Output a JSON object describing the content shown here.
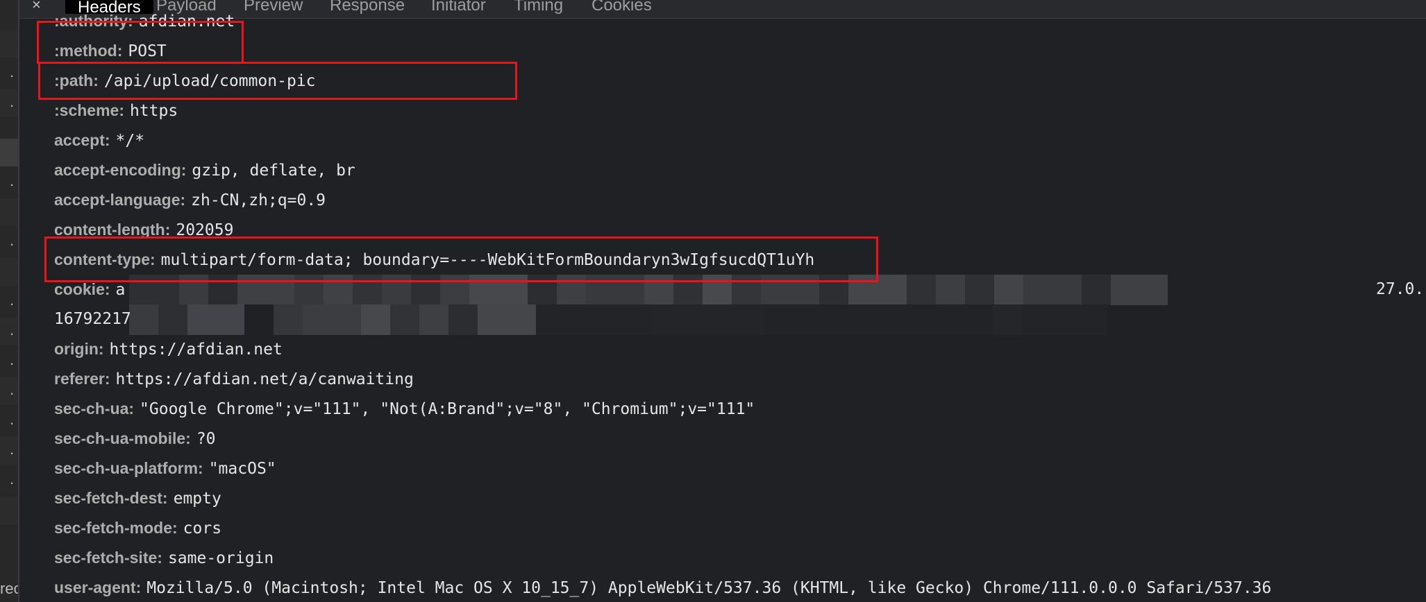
{
  "tabs": {
    "close_glyph": "×",
    "items": [
      {
        "label": "Headers",
        "active": true
      },
      {
        "label": "Payload"
      },
      {
        "label": "Preview"
      },
      {
        "label": "Response"
      },
      {
        "label": "Initiator"
      },
      {
        "label": "Timing"
      },
      {
        "label": "Cookies"
      }
    ]
  },
  "left_panel": {
    "row_glyph": ".",
    "bottom_text": "rec"
  },
  "headers": [
    {
      "name": ":authority:",
      "value": "afdian.net"
    },
    {
      "name": ":method:",
      "value": "POST"
    },
    {
      "name": ":path:",
      "value": "/api/upload/common-pic"
    },
    {
      "name": ":scheme:",
      "value": "https"
    },
    {
      "name": "accept:",
      "value": "*/*"
    },
    {
      "name": "accept-encoding:",
      "value": "gzip, deflate, br"
    },
    {
      "name": "accept-language:",
      "value": "zh-CN,zh;q=0.9"
    },
    {
      "name": "content-length:",
      "value": "202059"
    },
    {
      "name": "content-type:",
      "value": "multipart/form-data; boundary=----WebKitFormBoundaryn3wIgfsucdQT1uYh"
    },
    {
      "name": "cookie:",
      "value": "a",
      "value_tail": "27.0.",
      "line2_head": "16792217"
    },
    {
      "name": "origin:",
      "value": "https://afdian.net"
    },
    {
      "name": "referer:",
      "value": "https://afdian.net/a/canwaiting"
    },
    {
      "name": "sec-ch-ua:",
      "value": "\"Google Chrome\";v=\"111\", \"Not(A:Brand\";v=\"8\", \"Chromium\";v=\"111\""
    },
    {
      "name": "sec-ch-ua-mobile:",
      "value": "?0"
    },
    {
      "name": "sec-ch-ua-platform:",
      "value": "\"macOS\""
    },
    {
      "name": "sec-fetch-dest:",
      "value": "empty"
    },
    {
      "name": "sec-fetch-mode:",
      "value": "cors"
    },
    {
      "name": "sec-fetch-site:",
      "value": "same-origin"
    },
    {
      "name": "user-agent:",
      "value": "Mozilla/5.0 (Macintosh; Intel Mac OS X 10_15_7) AppleWebKit/537.36 (KHTML, like Gecko) Chrome/111.0.0.0 Safari/537.36"
    }
  ],
  "colors": {
    "background": "#202124",
    "annotation_red": "#e8161c",
    "header_name": "#aeaeae",
    "header_value": "#e6e6e6"
  }
}
